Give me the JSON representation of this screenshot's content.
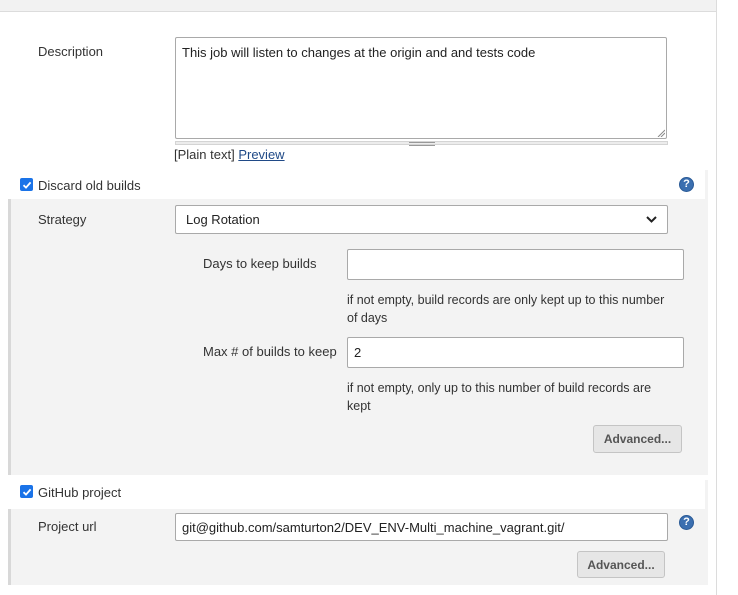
{
  "description": {
    "label": "Description",
    "value": "This job will listen to changes at the origin and and tests code",
    "plain_text": "[Plain text]",
    "preview": "Preview"
  },
  "discard_old_builds": {
    "label": "Discard old builds",
    "checked": true,
    "strategy_label": "Strategy",
    "strategy_value": "Log Rotation",
    "days_label": "Days to keep builds",
    "days_value": "",
    "days_hint_line1": "if not empty, build records are only kept up to this number",
    "days_hint_line2": "of days",
    "max_label": "Max # of builds to keep",
    "max_value": "2",
    "max_hint_line1": "if not empty, only up to this number of build records are",
    "max_hint_line2": "kept",
    "advanced": "Advanced..."
  },
  "github_project": {
    "label": "GitHub project",
    "checked": true,
    "url_label": "Project url",
    "url_value": "git@github.com/samturton2/DEV_ENV-Multi_machine_vagrant.git/",
    "advanced": "Advanced..."
  },
  "icons": {
    "checkbox": "checkmark-icon",
    "help": "help-icon",
    "dropdown": "chevron-down-icon",
    "resize": "resize-grip-icon"
  },
  "colors": {
    "checkbox": "#1a73e8",
    "help": "#3b6fb0",
    "link": "#204a87",
    "section_bg": "#f3f3f3"
  }
}
